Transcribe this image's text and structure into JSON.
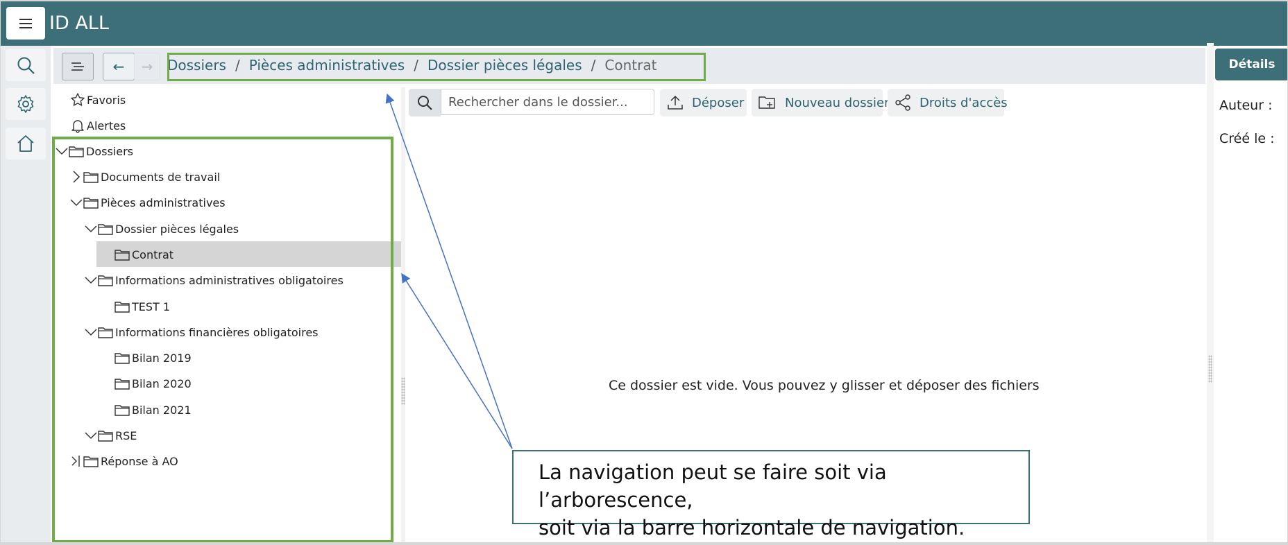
{
  "app": {
    "title": "ID ALL"
  },
  "nav": {
    "back_label": "←",
    "forward_label": "→",
    "breadcrumbs": [
      {
        "label": "Dossiers"
      },
      {
        "label": "Pièces administratives"
      },
      {
        "label": "Dossier pièces légales"
      },
      {
        "label": "Contrat"
      }
    ],
    "separator": "/"
  },
  "tree": {
    "favorites": "Favoris",
    "alerts": "Alertes",
    "root": "Dossiers",
    "items": [
      {
        "label": "Documents de travail"
      },
      {
        "label": "Pièces administratives"
      },
      {
        "label": "Dossier pièces légales"
      },
      {
        "label": "Contrat"
      },
      {
        "label": "Informations administratives obligatoires"
      },
      {
        "label": "TEST 1"
      },
      {
        "label": "Informations financières obligatoires"
      },
      {
        "label": "Bilan 2019"
      },
      {
        "label": "Bilan 2020"
      },
      {
        "label": "Bilan 2021"
      },
      {
        "label": "RSE"
      },
      {
        "label": "Réponse à AO"
      }
    ],
    "selected": "Contrat"
  },
  "toolbar": {
    "search_placeholder": "Rechercher dans le dossier...",
    "upload_label": "Déposer",
    "new_folder_label": "Nouveau dossier",
    "access_rights_label": "Droits d'accès"
  },
  "content": {
    "empty_message": "Ce dossier est vide. Vous pouvez y glisser et déposer des fichiers"
  },
  "details": {
    "button_label": "Détails",
    "author_label": "Auteur :",
    "created_label": "Créé le :"
  },
  "annotation": {
    "line1": "La navigation peut se faire soit via l’arborescence,",
    "line2": "soit via la barre horizontale de navigation."
  },
  "colors": {
    "header": "#3d6f78",
    "highlight_box": "#70ad47",
    "link": "#2d6370",
    "arrow": "#4472c4"
  }
}
